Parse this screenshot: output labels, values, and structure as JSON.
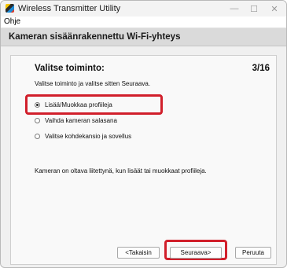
{
  "window": {
    "title": "Wireless Transmitter Utility",
    "min_glyph": "—",
    "max_glyph": "☐",
    "close_glyph": "✕"
  },
  "menu": {
    "items": [
      "Ohje"
    ]
  },
  "header": {
    "title": "Kameran sisäänrakennettu Wi-Fi-yhteys"
  },
  "step": {
    "title": "Valitse toiminto:",
    "counter": "3/16",
    "instruction": "Valitse toiminto ja valitse sitten Seuraava."
  },
  "options": [
    {
      "label": "Lisää/Muokkaa profiileja",
      "selected": true
    },
    {
      "label": "Vaihda kameran salasana",
      "selected": false
    },
    {
      "label": "Valitse kohdekansio ja sovellus",
      "selected": false
    }
  ],
  "note": "Kameran on oltava liitettynä, kun lisäät tai muokkaat profiileja.",
  "buttons": {
    "back": "<Takaisin",
    "next": "Seuraava>",
    "cancel": "Peruuta"
  },
  "colors": {
    "highlight": "#d11f2b",
    "header_bg": "#dadada"
  }
}
